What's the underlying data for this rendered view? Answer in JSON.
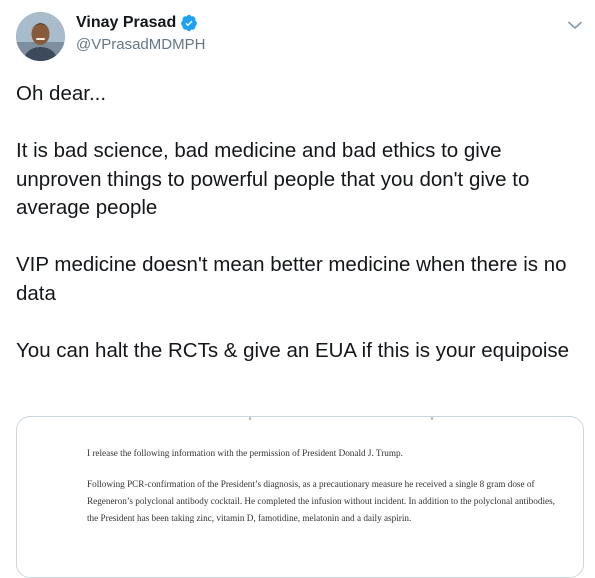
{
  "author": {
    "name": "Vinay Prasad",
    "handle": "@VPrasadMDMPH",
    "verified": true
  },
  "icons": {
    "verified": "verified-badge-icon",
    "menu": "chevron-down-icon"
  },
  "colors": {
    "verified_blue": "#1da1f2",
    "handle_gray": "#657786",
    "border": "#ccd6dd"
  },
  "tweet": {
    "paragraphs": [
      "Oh dear...",
      "It is bad science, bad medicine and bad ethics to give unproven things to powerful people that you don't give to average people",
      "VIP medicine doesn't mean better medicine when there is no data",
      "You can halt the RCTs & give an EUA if this is your equipoise"
    ]
  },
  "media": {
    "document_paragraphs": [
      "I release the following information with the permission of President Donald J. Trump.",
      "Following PCR-confirmation of the President’s diagnosis, as a precautionary measure he received a single 8 gram dose of Regeneron’s polyclonal antibody cocktail.  He completed the infusion without incident.  In addition to the polyclonal antibodies, the President has been taking zinc, vitamin D, famotidine, melatonin and a daily aspirin."
    ]
  }
}
